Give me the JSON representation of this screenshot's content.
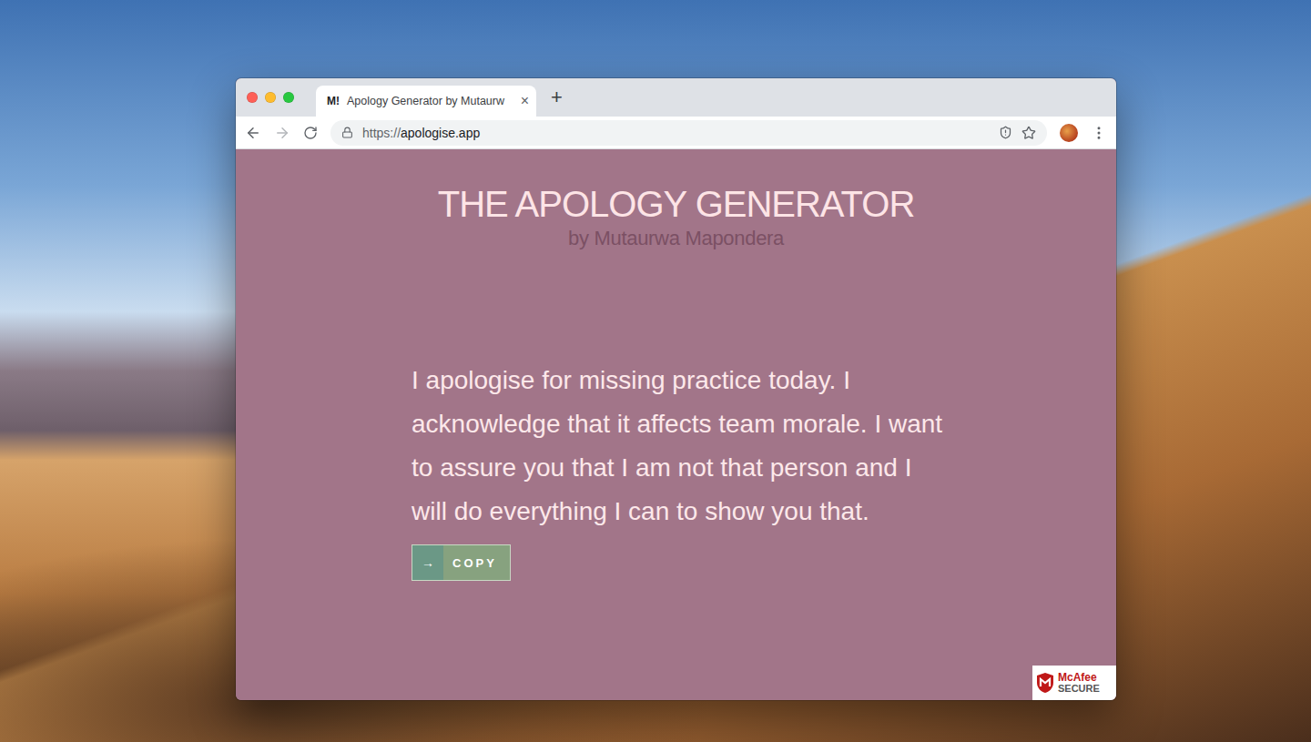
{
  "browser": {
    "tabs": [
      {
        "favicon": "M!",
        "title": "Apology Generator by Mutaurw",
        "close": "×",
        "selected": true
      }
    ],
    "new_tab": "+",
    "address": {
      "scheme": "https://",
      "host": "apologise.app"
    },
    "forward_enabled": false
  },
  "page": {
    "title": "THE APOLOGY GENERATOR",
    "byline": "by Mutaurwa Mapondera",
    "apology": "I apologise for missing practice today. I acknowledge that it affects team morale. I want to assure you that I am not that person and I will do everything I can to show you that.",
    "copy_button": {
      "arrow": "→",
      "label": "COPY"
    }
  },
  "badge": {
    "brand": "McAfee",
    "label": "SECURE"
  }
}
